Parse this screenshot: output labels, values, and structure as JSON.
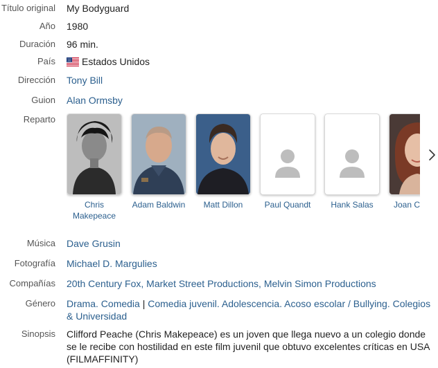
{
  "details": {
    "original_title": {
      "label": "Título original",
      "value": "My Bodyguard"
    },
    "year": {
      "label": "Año",
      "value": "1980"
    },
    "duration": {
      "label": "Duración",
      "value": "96 min."
    },
    "country": {
      "label": "País",
      "value": "Estados Unidos",
      "flag_icon": "us-flag-icon"
    },
    "direction": {
      "label": "Dirección",
      "value": "Tony Bill"
    },
    "script": {
      "label": "Guion",
      "value": "Alan Ormsby"
    },
    "cast": {
      "label": "Reparto",
      "members": [
        {
          "name": "Chris Makepeace",
          "photo": "bw-portrait"
        },
        {
          "name": "Adam Baldwin",
          "photo": "color-portrait"
        },
        {
          "name": "Matt Dillon",
          "photo": "color-portrait"
        },
        {
          "name": "Paul Quandt",
          "photo": "placeholder-person-icon"
        },
        {
          "name": "Hank Salas",
          "photo": "placeholder-person-icon"
        },
        {
          "name": "Joan Cusack",
          "photo": "color-portrait"
        }
      ],
      "next_icon": "chevron-right-icon"
    },
    "music": {
      "label": "Música",
      "value": "Dave Grusin"
    },
    "photography": {
      "label": "Fotografía",
      "value": "Michael D. Margulies"
    },
    "companies": {
      "label": "Compañías",
      "items": [
        "20th Century Fox",
        "Market Street Productions",
        "Melvin Simon Productions"
      ]
    },
    "genre": {
      "label": "Género",
      "group1": [
        "Drama",
        "Comedia"
      ],
      "group2": [
        "Comedia juvenil",
        "Adolescencia",
        "Acoso escolar / Bullying",
        "Colegios & Universidad"
      ]
    },
    "synopsis": {
      "label": "Sinopsis",
      "value": "Clifford Peache (Chris Makepeace) es un joven que llega nuevo a un colegio donde se le recibe con hostilidad en este film juvenil que obtuvo excelentes críticas en USA (FILMAFFINITY)"
    }
  },
  "colors": {
    "link": "#2b5f8e",
    "label": "#555555",
    "text": "#1f1f1f"
  }
}
